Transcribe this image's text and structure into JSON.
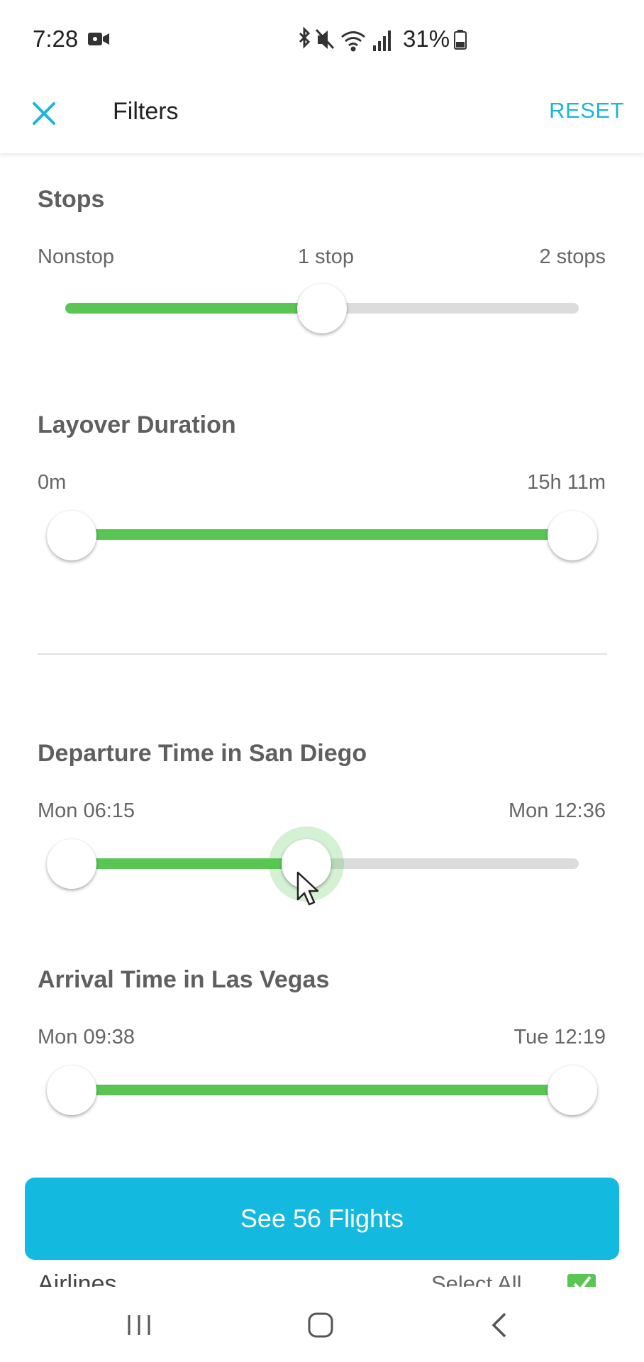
{
  "status_bar": {
    "time": "7:28",
    "battery": "31%"
  },
  "header": {
    "title": "Filters",
    "reset_label": "RESET"
  },
  "stops": {
    "title": "Stops",
    "labels": [
      "Nonstop",
      "1 stop",
      "2 stops"
    ],
    "selected_index": 1
  },
  "layover": {
    "title": "Layover Duration",
    "min_label": "0m",
    "max_label": "15h 11m"
  },
  "departure": {
    "title": "Departure Time in San Diego",
    "min_label": "Mon 06:15",
    "max_label": "Mon 12:36"
  },
  "arrival": {
    "title": "Arrival Time in Las Vegas",
    "min_label": "Mon 09:38",
    "max_label": "Tue 12:19"
  },
  "cta": {
    "label": "See 56 Flights"
  },
  "airlines": {
    "title": "Airlines",
    "select_all_label": "Select All"
  },
  "colors": {
    "accent": "#1ab6d8",
    "cta": "#14b9e0",
    "slider_fill": "#59c653",
    "slider_track": "#dcdcdc"
  }
}
